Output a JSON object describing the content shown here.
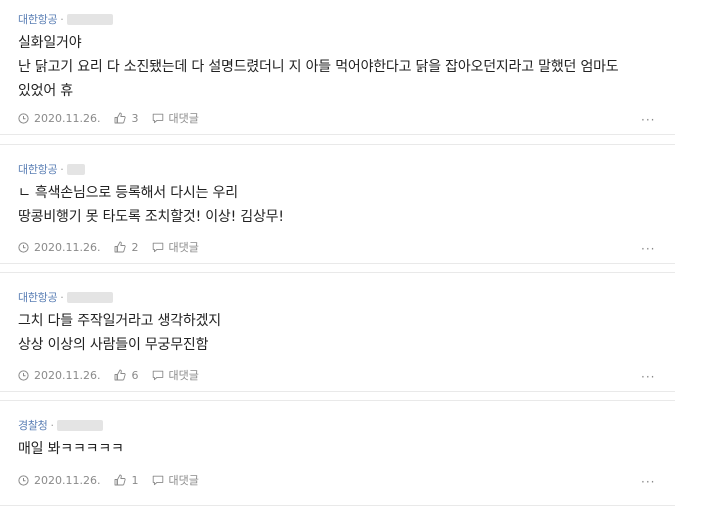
{
  "comments": [
    {
      "author": "대한항공",
      "separator": "·",
      "lines": [
        "실화일거야",
        "난 닭고기 요리 다 소진됐는데 다 설명드렸더니 지 아들 먹어야한다고 닭을 잡아오던지라고 말했던 엄마도",
        "있었어 휴"
      ],
      "date": "2020.11.26.",
      "likes": "3",
      "reply_label": "대댓글",
      "more": "···"
    },
    {
      "author": "대한항공",
      "separator": "·",
      "lines": [
        "ㄴ 흑색손님으로 등록해서 다시는 우리",
        "땅콩비행기 못 타도록 조치할것! 이상! 김상무!"
      ],
      "date": "2020.11.26.",
      "likes": "2",
      "reply_label": "대댓글",
      "more": "···"
    },
    {
      "author": "대한항공",
      "separator": "·",
      "lines": [
        "그치 다들 주작일거라고 생각하겠지",
        "상상 이상의 사람들이 무궁무진함"
      ],
      "date": "2020.11.26.",
      "likes": "6",
      "reply_label": "대댓글",
      "more": "···"
    },
    {
      "author": "경찰청",
      "separator": "·",
      "lines": [
        "매일 봐ㅋㅋㅋㅋㅋ"
      ],
      "date": "2020.11.26.",
      "likes": "1",
      "reply_label": "대댓글",
      "more": "···"
    }
  ],
  "icons": {
    "date": "clock-icon",
    "like": "thumbs-up-icon",
    "reply": "speech-bubble-icon",
    "more": "more-dots-icon"
  },
  "colors": {
    "author": "#5b7fb5",
    "meta_text": "#8a8a8a",
    "body_text": "#222222",
    "divider": "#e9e9e9"
  }
}
